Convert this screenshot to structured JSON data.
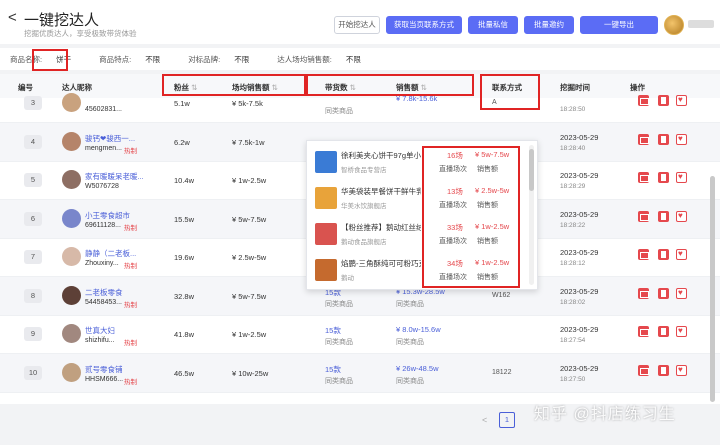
{
  "header": {
    "back_label": "<",
    "title": "一键挖达人",
    "subtitle": "挖掘优质达人，享受极致带货体验",
    "buttons": [
      "开始挖达人",
      "获取当页联系方式",
      "批量私信",
      "批量邀约",
      "一键导出"
    ]
  },
  "filters": [
    {
      "label": "商品名称:",
      "value": "饼干"
    },
    {
      "label": "商品特点:",
      "value": "不限"
    },
    {
      "label": "对标品牌:",
      "value": "不限"
    },
    {
      "label": "达人场均销售额:",
      "value": "不限"
    }
  ],
  "columns": {
    "num": "编号",
    "name": "达人昵称",
    "fans": "粉丝",
    "sales": "场均销售额",
    "goods": "带货数",
    "gmv": "销售额",
    "contact": "联系方式",
    "time": "挖掘时间",
    "action": "操作"
  },
  "sort_icon": "⇅",
  "rows": [
    {
      "num": "3",
      "name": "",
      "id": "45602831...",
      "tag": "",
      "fans": "5.1w",
      "sales": "¥ 5k-7.5k",
      "goods": "",
      "goods_sub": "同类商品",
      "gmv": "¥ 7.8k-15.6k",
      "gmv_sub": "",
      "contact": "A",
      "date": "",
      "time": "18:28:50",
      "avatar": "#c9a27e"
    },
    {
      "num": "4",
      "name": "骏钙❤骏西一...",
      "id": "mengmen...",
      "tag": "热制",
      "fans": "6.2w",
      "sales": "¥ 7.5k-1w",
      "goods": "",
      "goods_sub": "",
      "gmv": "",
      "gmv_sub": "",
      "contact": "",
      "date": "2023-05-29",
      "time": "18:28:40",
      "avatar": "#b5846a"
    },
    {
      "num": "5",
      "name": "家有暖暖呆老暖...",
      "id": "W5076728",
      "tag": "",
      "fans": "10.4w",
      "sales": "¥ 1w-2.5w",
      "goods": "",
      "goods_sub": "",
      "gmv": "",
      "gmv_sub": "",
      "contact": "",
      "date": "2023-05-29",
      "time": "18:28:29",
      "avatar": "#8d6e63"
    },
    {
      "num": "6",
      "name": "小王零食超市",
      "id": "69611128...",
      "tag": "热制",
      "fans": "15.5w",
      "sales": "¥ 5w-7.5w",
      "goods": "",
      "goods_sub": "",
      "gmv": "",
      "gmv_sub": "",
      "contact": "",
      "date": "2023-05-29",
      "time": "18:28:22",
      "avatar": "#7986cb"
    },
    {
      "num": "7",
      "name": "静静（二老板...",
      "id": "Zhouxiny...",
      "tag": "热制",
      "fans": "19.6w",
      "sales": "¥ 2.5w-5w",
      "goods": "",
      "goods_sub": "",
      "gmv": "",
      "gmv_sub": "",
      "contact": "",
      "date": "2023-05-29",
      "time": "18:28:12",
      "avatar": "#d7b9a8"
    },
    {
      "num": "8",
      "name": "二老板零食",
      "id": "54458453...",
      "tag": "热制",
      "fans": "32.8w",
      "sales": "¥ 5w-7.5w",
      "goods": "15款",
      "goods_sub": "同类商品",
      "gmv": "¥ 15.3w-28.5w",
      "gmv_sub": "同类商品",
      "contact": "W162",
      "date": "2023-05-29",
      "time": "18:28:02",
      "avatar": "#5d4037"
    },
    {
      "num": "9",
      "name": "世真大妇",
      "id": "shizhifu...",
      "tag": "热制",
      "fans": "41.8w",
      "sales": "¥ 1w-2.5w",
      "goods": "15款",
      "goods_sub": "同类商品",
      "gmv": "¥ 8.0w-15.6w",
      "gmv_sub": "同类商品",
      "contact": "",
      "date": "2023-05-29",
      "time": "18:27:54",
      "avatar": "#a1887f"
    },
    {
      "num": "10",
      "name": "贰号零食铺",
      "id": "HHSM666...",
      "tag": "热制",
      "fans": "46.5w",
      "sales": "¥ 10w-25w",
      "goods": "15款",
      "goods_sub": "同类商品",
      "gmv": "¥ 26w-48.5w",
      "gmv_sub": "同类商品",
      "contact": "18122",
      "date": "2023-05-29",
      "time": "18:27:50",
      "avatar": "#c0a080"
    }
  ],
  "popup": {
    "items": [
      {
        "title": "徐利美夹心饼干97g单小盒巧...",
        "shop": "智桥食品专营店",
        "count": "16场",
        "range": "¥ 5w-7.5w",
        "label1": "直播场次",
        "label2": "销售额",
        "color": "#3a7bd5"
      },
      {
        "title": "华美袋装早餐饼干鲜牛乳味黑...",
        "shop": "华美水饮旗舰店",
        "count": "13场",
        "range": "¥ 2.5w-5w",
        "label1": "直播场次",
        "label2": "销售额",
        "color": "#e8a33a"
      },
      {
        "title": "【粉丝推荐】鹅动红丝绒牛奶...",
        "shop": "鹅动食品旗舰店",
        "count": "33场",
        "range": "¥ 1w-2.5w",
        "label1": "直播场次",
        "label2": "销售额",
        "color": "#d9534f"
      },
      {
        "title": "焰鹏-三角酥纯可可粉巧克力味...",
        "shop": "鹅动",
        "count": "34场",
        "range": "¥ 1w-2.5w",
        "label1": "直播场次",
        "label2": "销售额",
        "color": "#c56a2e"
      }
    ]
  },
  "pager": {
    "prev": "<",
    "current": "1"
  },
  "watermark": "知乎 @抖店练习生"
}
